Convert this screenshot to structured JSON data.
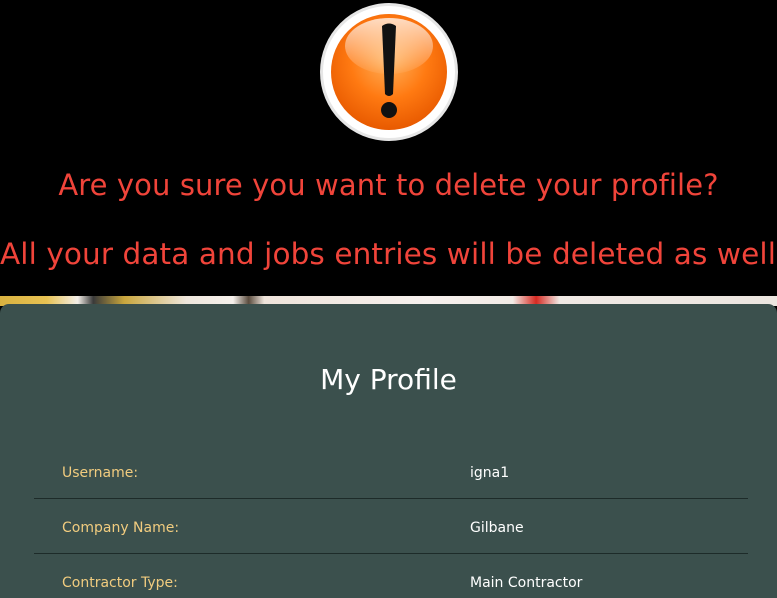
{
  "alert": {
    "icon": "exclamation-warning-icon",
    "icon_color": "#ff7a12",
    "line1": "Are you sure you want to delete your profile?",
    "line2": "All your data and jobs entries will be deleted as well!",
    "text_color": "#f0443a"
  },
  "profile": {
    "title": "My Profile",
    "background_color": "#3b504d",
    "label_color": "#f1cc7f",
    "rows": [
      {
        "label": "Username:",
        "value": "igna1"
      },
      {
        "label": "Company Name:",
        "value": "Gilbane"
      },
      {
        "label": "Contractor Type:",
        "value": "Main Contractor"
      }
    ]
  }
}
